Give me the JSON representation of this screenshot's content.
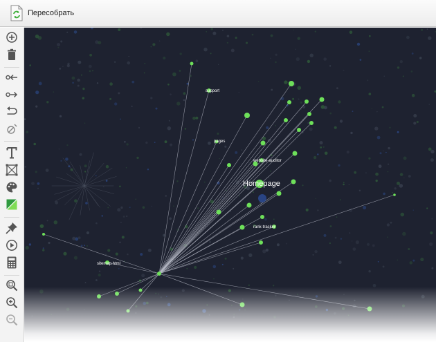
{
  "toolbar": {
    "rebuild_label": "Пересобрать"
  },
  "sidebar": {
    "tools": [
      {
        "name": "add-node-icon"
      },
      {
        "name": "trash-icon"
      },
      {
        "name": "incoming-links-icon"
      },
      {
        "name": "outgoing-links-icon"
      },
      {
        "name": "undo-icon"
      },
      {
        "name": "hide-node-icon"
      },
      {
        "name": "text-icon"
      },
      {
        "name": "layout-icon"
      },
      {
        "name": "palette-icon"
      },
      {
        "name": "color-fill-icon"
      },
      {
        "name": "pin-icon"
      },
      {
        "name": "play-icon"
      },
      {
        "name": "calculator-icon"
      },
      {
        "name": "zoom-fit-icon"
      },
      {
        "name": "zoom-in-icon"
      },
      {
        "name": "zoom-out-icon"
      }
    ]
  },
  "graph": {
    "background": "#1e2230",
    "node_color": "#6ee05a",
    "edge_color": "#b9bcc8",
    "labels": {
      "support": "support",
      "pages": "pages",
      "website_auditor": "website-auditor",
      "homepage": "Homepage",
      "rank_tracker": "rank-tracker",
      "sitemap": "sitemap.html"
    }
  }
}
